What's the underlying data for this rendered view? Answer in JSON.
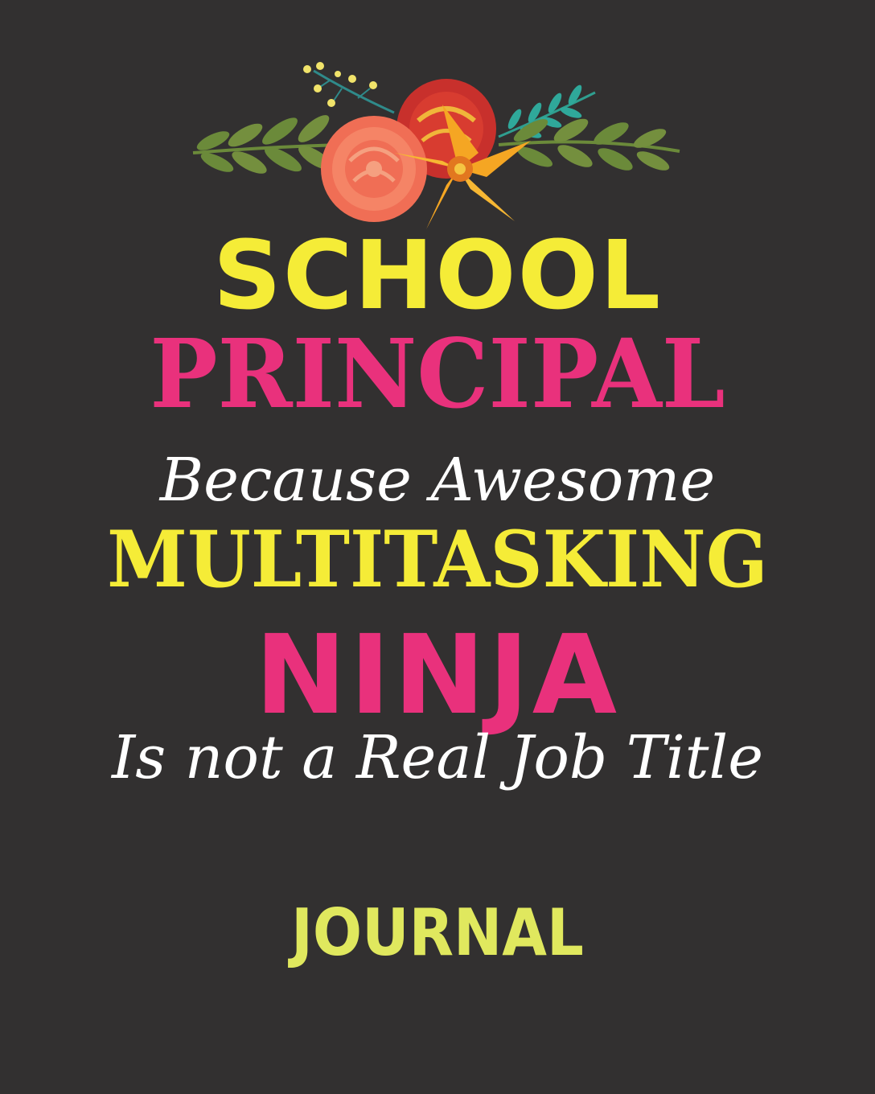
{
  "cover": {
    "line1": "SCHOOL",
    "line2": "PRINCIPAL",
    "line3": "Because Awesome",
    "line4": "MULTITASKING",
    "line5": "NINJA",
    "line6": "Is not a Real Job Title",
    "footer": "JOURNAL"
  },
  "colors": {
    "background": "#323030",
    "yellow": "#f5ec37",
    "pink": "#e9317c",
    "white": "#ffffff",
    "pale_yellow": "#e0e85e"
  },
  "icons": [
    "floral-bouquet-icon"
  ]
}
